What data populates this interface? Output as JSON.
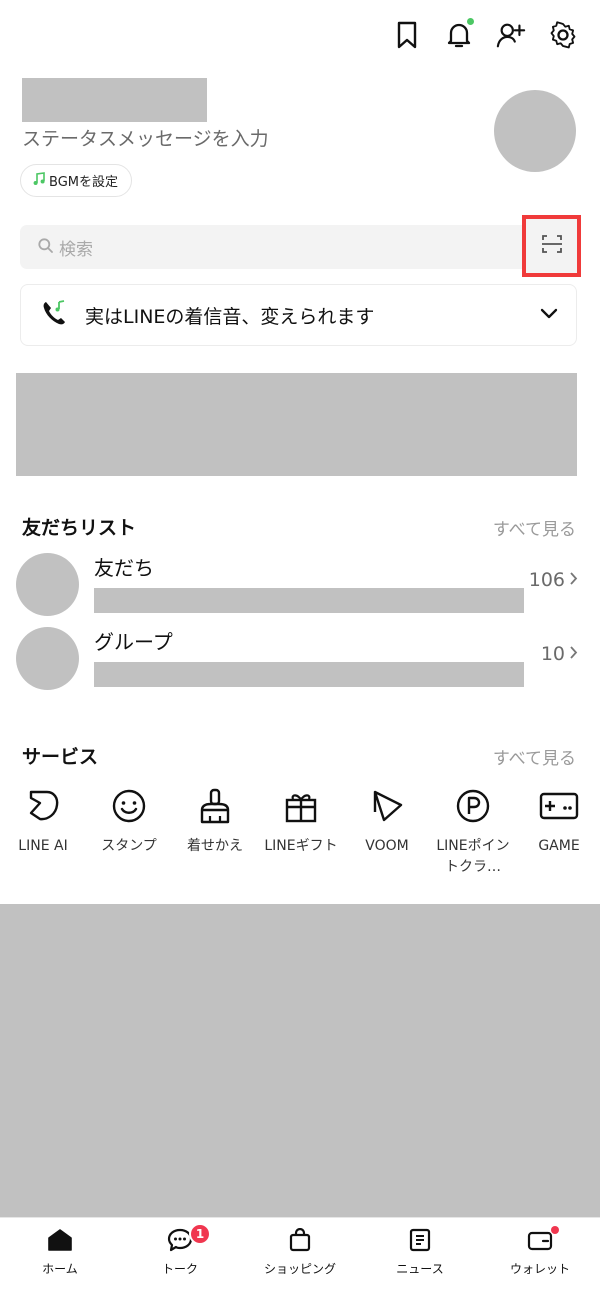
{
  "profile": {
    "status_placeholder": "ステータスメッセージを入力",
    "bgm_label": "BGMを設定"
  },
  "search": {
    "placeholder": "検索"
  },
  "promo": {
    "text": "実はLINEの着信音、変えられます"
  },
  "friends_section": {
    "title": "友だちリスト",
    "see_all": "すべて見る",
    "rows": [
      {
        "label": "友だち",
        "count": "106"
      },
      {
        "label": "グループ",
        "count": "10"
      }
    ]
  },
  "services_section": {
    "title": "サービス",
    "see_all": "すべて見る",
    "items": [
      {
        "label": "LINE AI",
        "icon": "line-ai-icon"
      },
      {
        "label": "スタンプ",
        "icon": "smiley-icon"
      },
      {
        "label": "着せかえ",
        "icon": "brush-icon"
      },
      {
        "label": "LINEギフト",
        "icon": "gift-icon"
      },
      {
        "label": "VOOM",
        "icon": "voom-icon"
      },
      {
        "label": "LINEポイントクラ…",
        "icon": "point-icon"
      },
      {
        "label": "GAME",
        "icon": "gamepad-icon"
      }
    ]
  },
  "bottom_nav": {
    "items": [
      {
        "label": "ホーム",
        "icon": "home-icon"
      },
      {
        "label": "トーク",
        "icon": "chat-icon",
        "badge": "1"
      },
      {
        "label": "ショッピング",
        "icon": "shopping-bag-icon"
      },
      {
        "label": "ニュース",
        "icon": "news-icon"
      },
      {
        "label": "ウォレット",
        "icon": "wallet-icon"
      }
    ]
  },
  "colors": {
    "accent_green": "#4cc764",
    "badge_red": "#f0364f",
    "highlight_red": "#f03a3a",
    "placeholder_gray": "#c1c1c1"
  }
}
